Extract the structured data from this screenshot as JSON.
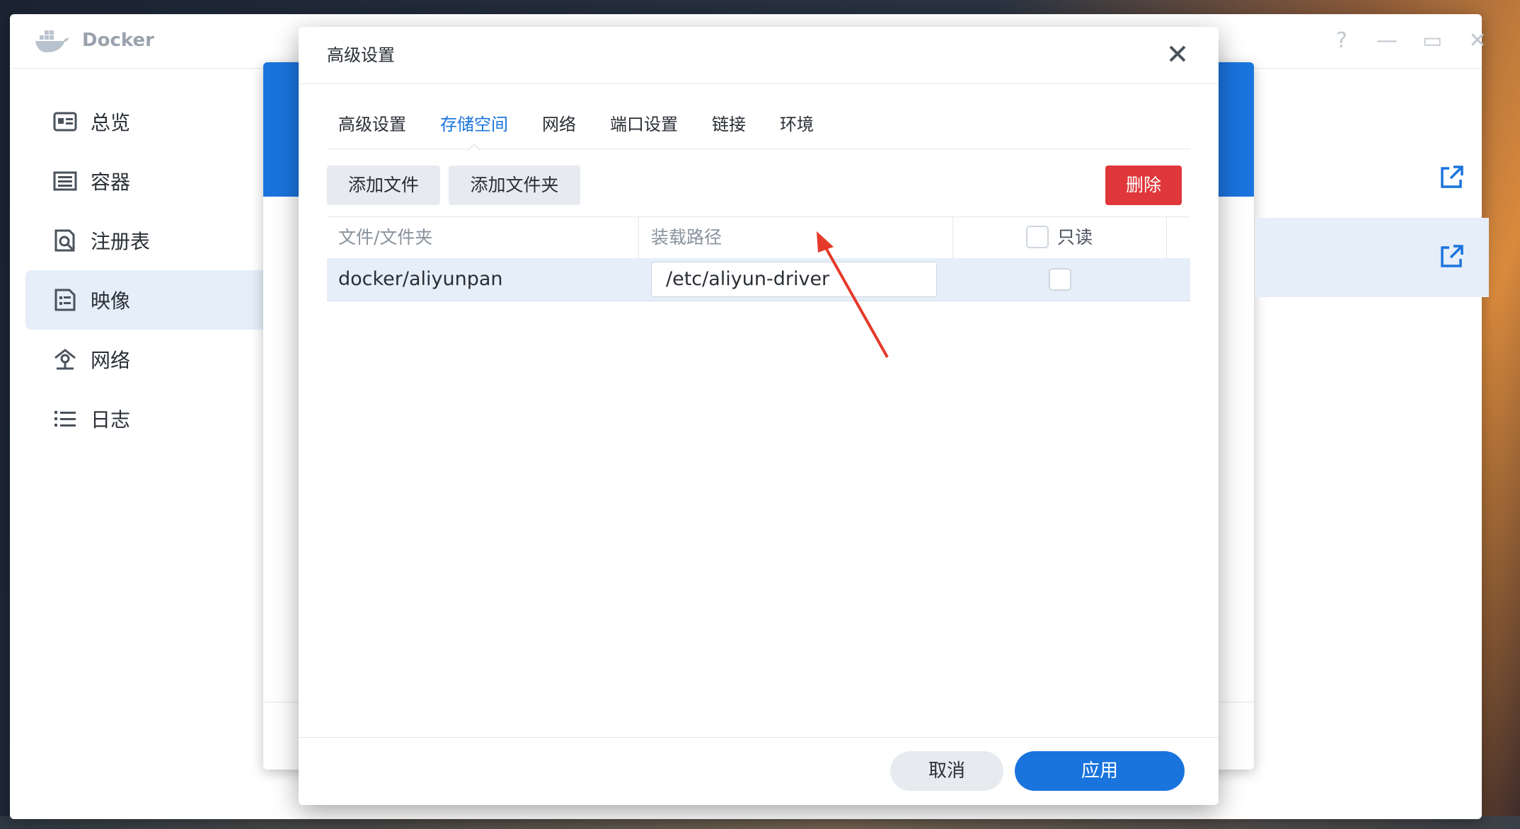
{
  "app": {
    "title": "Docker"
  },
  "window_controls": {
    "help": "?",
    "minimize": "—",
    "maximize": "▭",
    "close": "✕"
  },
  "sidebar": {
    "items": [
      {
        "label": "总览",
        "icon": "overview-icon"
      },
      {
        "label": "容器",
        "icon": "container-icon"
      },
      {
        "label": "注册表",
        "icon": "registry-icon"
      },
      {
        "label": "映像",
        "icon": "image-icon",
        "active": true
      },
      {
        "label": "网络",
        "icon": "network-icon"
      },
      {
        "label": "日志",
        "icon": "log-icon"
      }
    ]
  },
  "modal": {
    "title": "高级设置",
    "tabs": [
      {
        "label": "高级设置"
      },
      {
        "label": "存储空间",
        "active": true
      },
      {
        "label": "网络"
      },
      {
        "label": "端口设置"
      },
      {
        "label": "链接"
      },
      {
        "label": "环境"
      }
    ],
    "toolbar": {
      "add_file": "添加文件",
      "add_folder": "添加文件夹",
      "delete": "删除"
    },
    "table": {
      "headers": {
        "file_folder": "文件/文件夹",
        "mount_path": "装载路径",
        "readonly": "只读"
      },
      "rows": [
        {
          "file_folder": "docker/aliyunpan",
          "mount_path": "/etc/aliyun-driver",
          "readonly": false
        }
      ]
    },
    "footer": {
      "cancel": "取消",
      "apply": "应用"
    }
  },
  "colors": {
    "accent": "#1a74de",
    "danger": "#e0373a",
    "selected_row": "#e5eef9",
    "annotation": "#e53a2a"
  }
}
